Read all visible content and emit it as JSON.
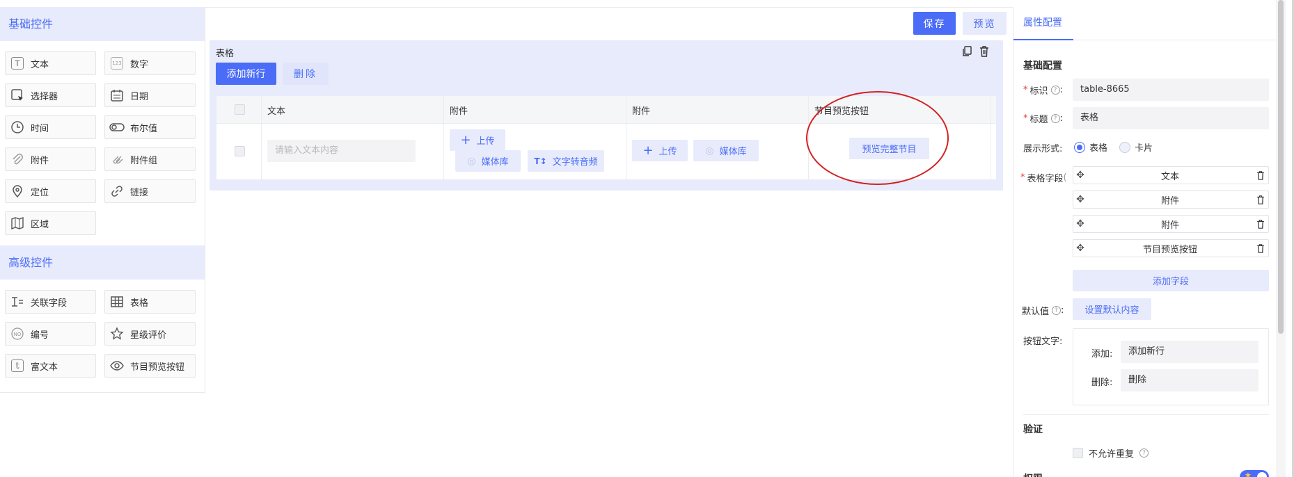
{
  "palette": {
    "basic_title": "基础控件",
    "basic_items": [
      {
        "label": "文本",
        "icon": "text-icon"
      },
      {
        "label": "数字",
        "icon": "number-icon"
      },
      {
        "label": "选择器",
        "icon": "selector-icon"
      },
      {
        "label": "日期",
        "icon": "calendar-icon"
      },
      {
        "label": "时间",
        "icon": "clock-icon"
      },
      {
        "label": "布尔值",
        "icon": "toggle-icon"
      },
      {
        "label": "附件",
        "icon": "paperclip-icon"
      },
      {
        "label": "附件组",
        "icon": "attachment-group-icon"
      },
      {
        "label": "定位",
        "icon": "location-pin-icon"
      },
      {
        "label": "链接",
        "icon": "link-icon"
      },
      {
        "label": "区域",
        "icon": "map-icon"
      }
    ],
    "advanced_title": "高级控件",
    "advanced_items": [
      {
        "label": "关联字段",
        "icon": "related-field-icon"
      },
      {
        "label": "表格",
        "icon": "table-icon"
      },
      {
        "label": "编号",
        "icon": "number-badge-icon"
      },
      {
        "label": "星级评价",
        "icon": "star-icon"
      },
      {
        "label": "富文本",
        "icon": "rich-text-icon"
      },
      {
        "label": "节目预览按钮",
        "icon": "eye-icon"
      }
    ]
  },
  "toolbar": {
    "save_label": "保存",
    "preview_label": "预览"
  },
  "table_block": {
    "title": "表格",
    "add_row_label": "添加新行",
    "delete_label": "删除",
    "columns": [
      "文本",
      "附件",
      "附件",
      "节目预览按钮"
    ],
    "text_placeholder": "请输入文本内容",
    "upload_label": "上传",
    "media_label": "媒体库",
    "tts_label": "文字转音频",
    "preview_full_label": "预览完整节目"
  },
  "panel": {
    "tab_label": "属性配置",
    "basic_config_title": "基础配置",
    "id_label": "标识",
    "id_value": "table-8665",
    "title_label": "标题",
    "title_value": "表格",
    "display_label": "展示形式:",
    "display_options": [
      "表格",
      "卡片"
    ],
    "display_selected": "表格",
    "fields_label": "表格字段",
    "fields": [
      "文本",
      "附件",
      "附件",
      "节目预览按钮"
    ],
    "add_field_label": "添加字段",
    "default_label": "默认值",
    "set_default_label": "设置默认内容",
    "button_text_label": "按钮文字:",
    "add_text_label": "添加:",
    "add_text_value": "添加新行",
    "delete_text_label": "删除:",
    "delete_text_value": "删除",
    "validation_title": "验证",
    "no_duplicate_label": "不允许重复",
    "permission_title": "权限"
  },
  "colors": {
    "accent": "#4a6cf7",
    "accent_light": "#e8ebfb",
    "required": "#e23c3c",
    "annotation": "#d42020"
  }
}
